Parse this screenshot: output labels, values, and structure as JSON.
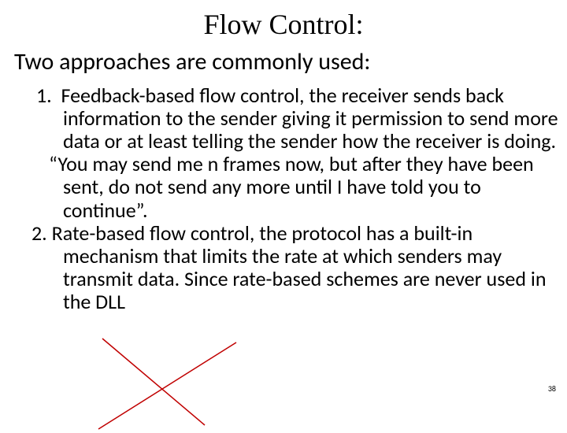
{
  "title": "Flow Control:",
  "subtitle": "Two approaches are commonly used:",
  "items": [
    {
      "number": "1.",
      "lead": "Feedback-based flow control, the receiver sends back information to the sender giving it permission to send more data or at least telling the sender how the receiver is doing.",
      "quote": "“You may send me n frames now, but after they have been sent, do not send any more until I have told you to continue”."
    },
    {
      "number": "2.",
      "text": "Rate-based flow control, the protocol has a built-in mechanism that limits the rate at which senders may transmit data. Since rate-based schemes are never used in the DLL"
    }
  ],
  "page_number": "38",
  "cross_color": "#c00000"
}
